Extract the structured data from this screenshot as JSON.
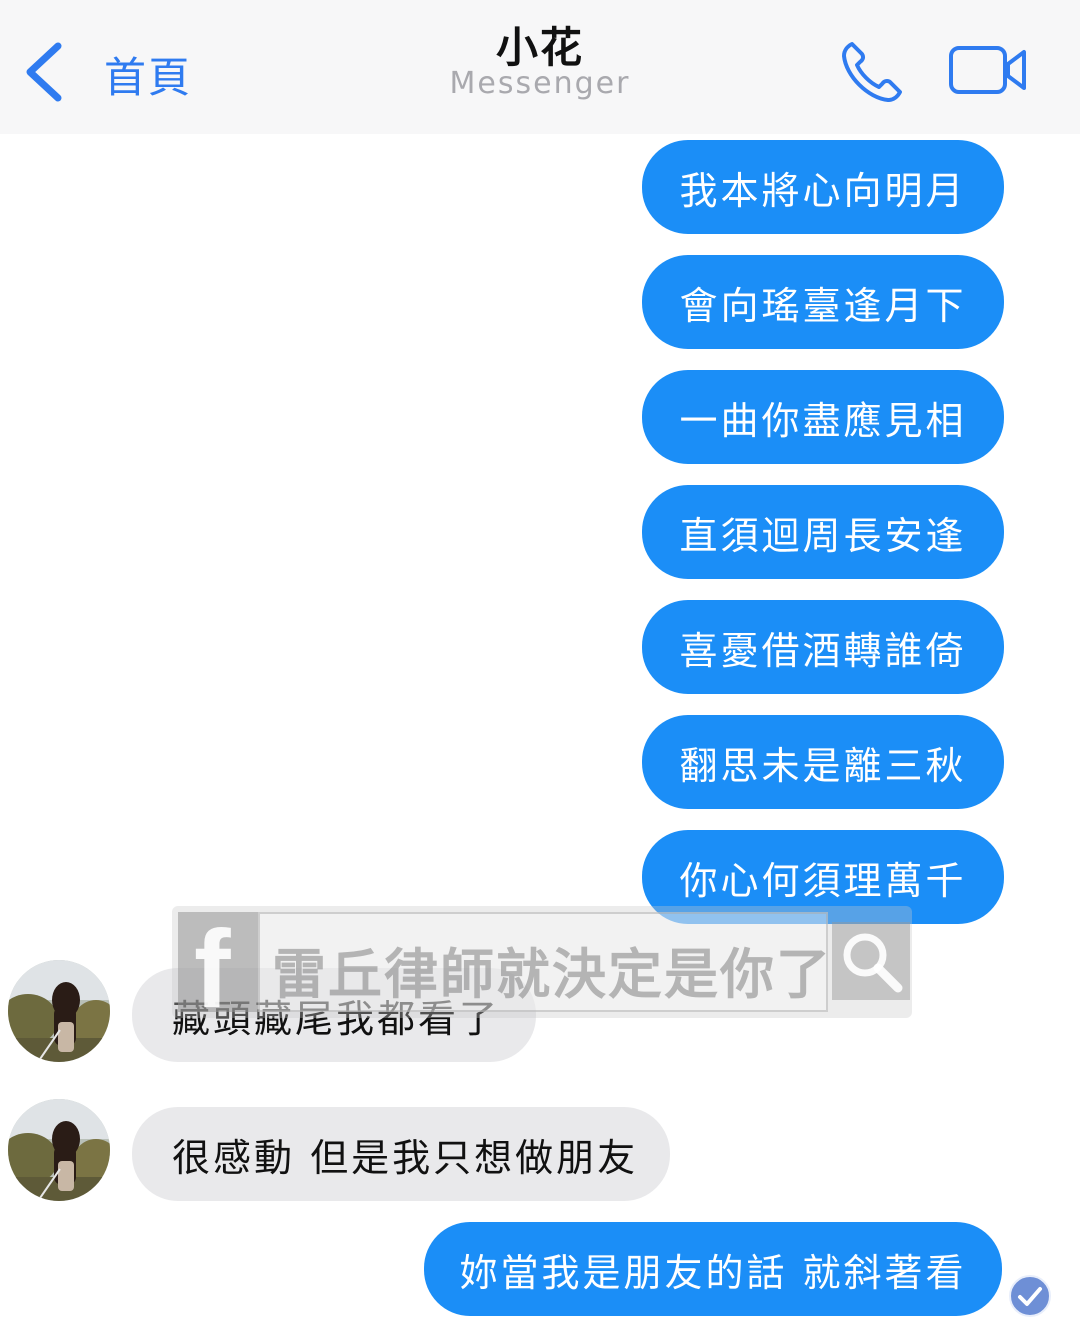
{
  "header": {
    "back_label": "首頁",
    "contact_name": "小花",
    "app_name": "Messenger"
  },
  "messages": [
    {
      "side": "sent",
      "text": "我本將心向明月"
    },
    {
      "side": "sent",
      "text": "會向瑤臺逢月下"
    },
    {
      "side": "sent",
      "text": "一曲你盡應見相"
    },
    {
      "side": "sent",
      "text": "直須迴周長安逢"
    },
    {
      "side": "sent",
      "text": "喜憂借酒轉誰倚"
    },
    {
      "side": "sent",
      "text": "翻思未是離三秋"
    },
    {
      "side": "sent",
      "text": "你心何須理萬千"
    },
    {
      "side": "received",
      "text": "藏頭藏尾我都看了"
    },
    {
      "side": "received",
      "text": "很感動 但是我只想做朋友"
    },
    {
      "side": "sent",
      "text": "妳當我是朋友的話 就斜著看"
    }
  ],
  "watermark": {
    "logo_letter": "f",
    "text": "雷丘律師就決定是你了"
  },
  "colors": {
    "accent": "#2f7bf0",
    "sent_bubble": "#1b8ef7",
    "received_bubble": "#e9e9eb",
    "header_bg": "#f7f7f8"
  },
  "icons": {
    "back": "chevron-left-icon",
    "call": "phone-icon",
    "video": "video-camera-icon",
    "read": "checkmark-circle-icon",
    "search": "search-icon"
  }
}
